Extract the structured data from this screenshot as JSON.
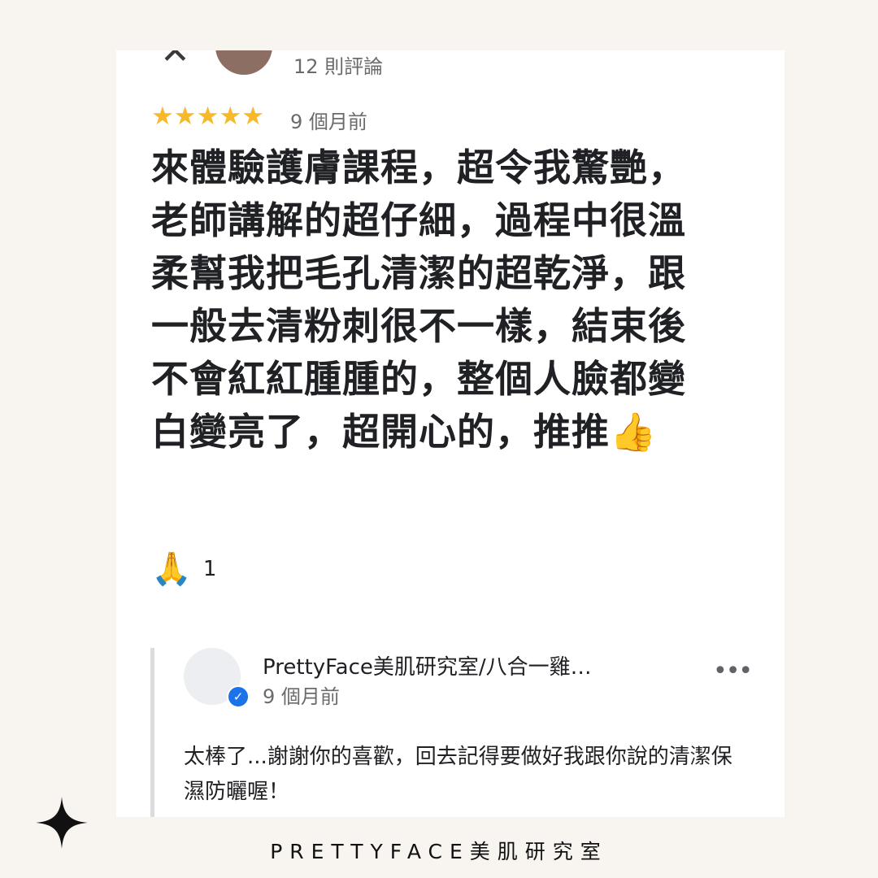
{
  "header": {
    "review_count": "12 則評論"
  },
  "review": {
    "rating": 5,
    "stars": [
      "★",
      "★",
      "★",
      "★",
      "★"
    ],
    "age": "9 個月前",
    "text": "來體驗護膚課程，超令我驚艷，老師講解的超仔細，過程中很溫柔幫我把毛孔清潔的超乾淨，跟一般去清粉刺很不一樣，結束後不會紅紅腫腫的，整個人臉都變白變亮了，超開心的，推推👍",
    "reaction_emoji": "🙏",
    "reaction_count": "1"
  },
  "owner_reply": {
    "name": "PrettyFace美肌研究室/八合一雞…",
    "age": "9 個月前",
    "text": "太棒了...謝謝你的喜歡，回去記得要做好我跟你說的清潔保濕防曬喔！",
    "more_glyph": "•••",
    "verified_glyph": "✓"
  },
  "footer": {
    "brand": "PRETTYFACE美肌研究室"
  },
  "colors": {
    "page_bg": "#f8f5f0",
    "star": "#f7b928",
    "verified": "#1a73e8"
  },
  "icons": {
    "close": "close-icon",
    "verified": "verified-badge-icon",
    "more": "more-options-icon",
    "sparkle": "sparkle-icon"
  }
}
